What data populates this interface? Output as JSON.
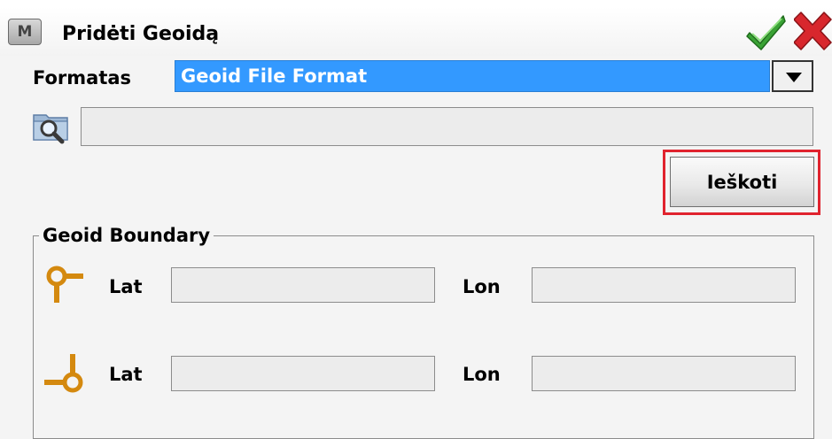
{
  "window": {
    "title": "Pridėti Geoidą",
    "menu_glyph": "M"
  },
  "header": {
    "ok_icon": "checkmark-icon",
    "cancel_icon": "close-icon",
    "colors": {
      "ok": "#3aa335",
      "cancel": "#d8272d"
    }
  },
  "format": {
    "label": "Formatas",
    "selected": "Geoid File Format",
    "highlight_color": "#3399ff"
  },
  "file": {
    "path_value": "",
    "search_icon": "folder-search-icon"
  },
  "browse": {
    "label": "Ieškoti",
    "highlight_color": "#e0232e"
  },
  "boundary": {
    "legend": "Geoid Boundary",
    "rows": [
      {
        "icon": "top-left-corner-icon",
        "lat_label": "Lat",
        "lat_value": "",
        "lon_label": "Lon",
        "lon_value": ""
      },
      {
        "icon": "bottom-right-corner-icon",
        "lat_label": "Lat",
        "lat_value": "",
        "lon_label": "Lon",
        "lon_value": ""
      }
    ],
    "icon_color": "#d4890f"
  }
}
